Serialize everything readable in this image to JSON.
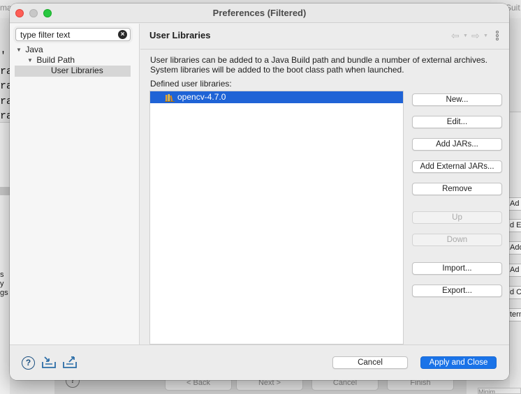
{
  "window": {
    "title": "Preferences (Filtered)"
  },
  "filter": {
    "value": "type filter text"
  },
  "tree": {
    "items": [
      {
        "label": "Java",
        "expanded": true
      },
      {
        "label": "Build Path",
        "expanded": true
      },
      {
        "label": "User Libraries",
        "selected": true
      }
    ]
  },
  "page": {
    "title": "User Libraries",
    "description_line1": "User libraries can be added to a Java Build path and bundle a number of external archives.",
    "description_line2": "System libraries will be added to the boot class path when launched.",
    "defined_label": "Defined user libraries:",
    "libraries": [
      {
        "name": "opencv-4.7.0",
        "selected": true
      }
    ]
  },
  "buttons": {
    "new": "New...",
    "edit": "Edit...",
    "add_jars": "Add JARs...",
    "add_external_jars": "Add External JARs...",
    "remove": "Remove",
    "up": "Up",
    "down": "Down",
    "import": "Import...",
    "export": "Export..."
  },
  "footer": {
    "cancel": "Cancel",
    "apply_close": "Apply and Close"
  },
  "background": {
    "code_chars": "'\nra\nra\nra\nra",
    "left_text": "s\ny\ngs",
    "right_buttons": [
      "Ad",
      "d Ex",
      "Add",
      "Ad",
      "d C",
      "tern"
    ],
    "bottom_buttons": [
      "< Back",
      "Next >",
      "Cancel",
      "Finish"
    ],
    "title_fragment_left": "mat",
    "title_fragment_right": "Suit",
    "corner_label": "Minim"
  },
  "colors": {
    "selection": "#1f63d6",
    "primary_button": "#1a73e8",
    "close": "#fe5f57",
    "maximize": "#28c840"
  }
}
